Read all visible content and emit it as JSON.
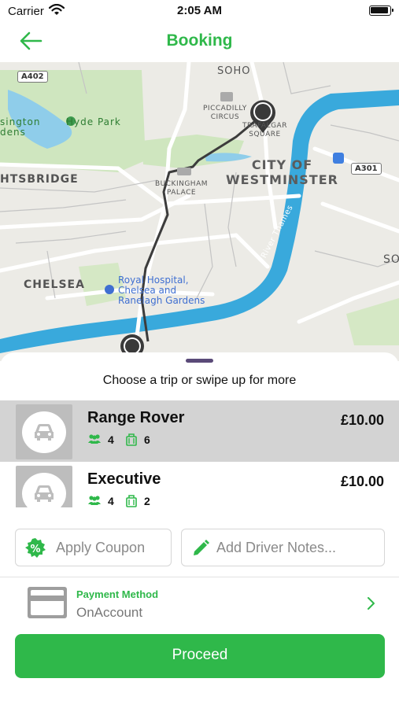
{
  "status_bar": {
    "carrier": "Carrier",
    "time": "2:05 AM"
  },
  "nav": {
    "title": "Booking",
    "back_icon": "arrow-left-icon"
  },
  "map": {
    "labels": {
      "soho": "SOHO",
      "westminster_line1": "CITY OF",
      "westminster_line2": "WESTMINSTER",
      "knightsbridge": "HTSBRIDGE",
      "chelsea": "CHELSEA",
      "so": "SO",
      "piccadilly_line1": "PICCADILLY",
      "piccadilly_line2": "CIRCUS",
      "trafalgar_line1": "TRAFALGAR",
      "trafalgar_line2": "SQUARE",
      "buckingham_line1": "BUCKINGHAM",
      "buckingham_line2": "PALACE",
      "hyde_park": "Hyde Park",
      "kensington_line1": "sington",
      "kensington_line2": "dens",
      "royal_line1": "Royal Hospital,",
      "royal_line2": "Chelsea and",
      "royal_line3": "Ranelagh Gardens",
      "thames": "River Thames"
    },
    "road_badges": {
      "a402": "A402",
      "a301": "A301"
    },
    "markers": {
      "start": "1",
      "end": "2"
    }
  },
  "sheet": {
    "hint": "Choose a trip or swipe up for more",
    "trips": [
      {
        "name": "Range Rover",
        "price": "£10.00",
        "passengers": "4",
        "luggage": "6",
        "selected": true
      },
      {
        "name": "Executive",
        "price": "£10.00",
        "passengers": "4",
        "luggage": "2",
        "selected": false
      }
    ],
    "coupon_label": "Apply Coupon",
    "notes_label": "Add Driver Notes...",
    "payment": {
      "title": "Payment Method",
      "value": "OnAccount"
    },
    "proceed_label": "Proceed"
  },
  "colors": {
    "accent": "#2fb84a",
    "river": "#39a9dc",
    "park": "#cfe6bf",
    "selected_row": "#d3d3d3"
  }
}
